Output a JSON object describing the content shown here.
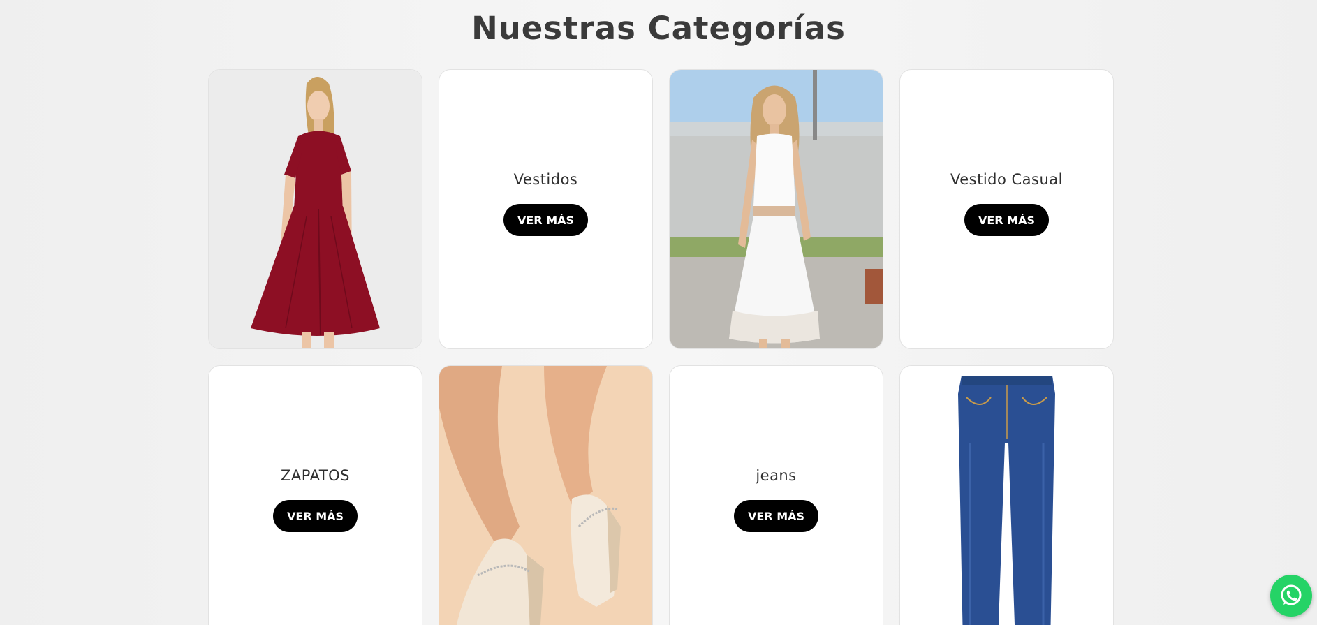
{
  "section": {
    "title": "Nuestras Categorías"
  },
  "cards": [
    {
      "type": "image",
      "image": "woman-red-dress-photo"
    },
    {
      "type": "category",
      "name": "Vestidos",
      "button": "VER MÁS"
    },
    {
      "type": "image",
      "image": "woman-white-lace-dress-photo"
    },
    {
      "type": "category",
      "name": "Vestido Casual",
      "button": "VER MÁS"
    },
    {
      "type": "category",
      "name": "ZAPATOS",
      "button": "VER MÁS"
    },
    {
      "type": "image",
      "image": "beige-heeled-shoes-photo"
    },
    {
      "type": "category",
      "name": "jeans",
      "button": "VER MÁS"
    },
    {
      "type": "image",
      "image": "blue-jeans-photo"
    }
  ],
  "whatsapp": {
    "icon": "whatsapp-icon",
    "color": "#25d366"
  }
}
